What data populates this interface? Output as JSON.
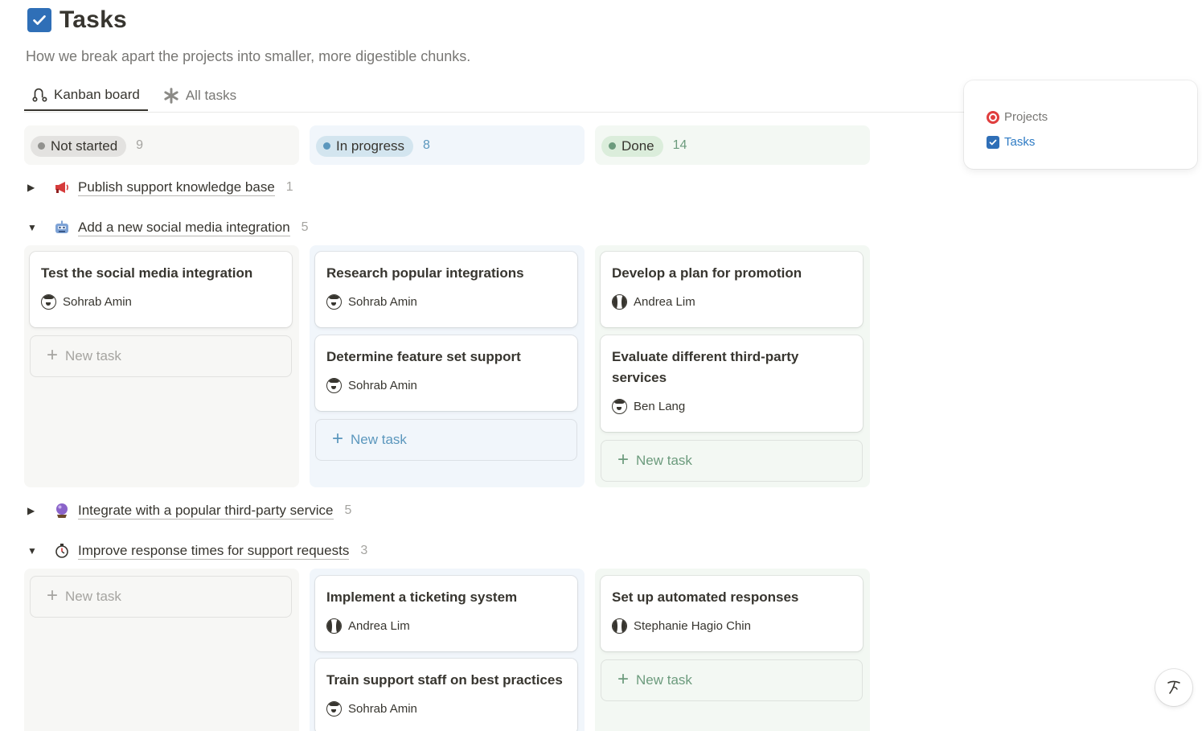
{
  "page": {
    "title": "Tasks",
    "description": "How we break apart the projects into smaller, more digestible chunks."
  },
  "tabs": [
    {
      "label": "Kanban board",
      "icon": "kanban-icon",
      "active": true
    },
    {
      "label": "All tasks",
      "icon": "asterisk-icon",
      "active": false
    }
  ],
  "popover": {
    "items": [
      {
        "label": "Projects",
        "icon": "target-icon"
      },
      {
        "label": "Tasks",
        "icon": "checkbox-icon"
      }
    ]
  },
  "columns": [
    {
      "label": "Not started",
      "count": "9",
      "color": "#91918e"
    },
    {
      "label": "In progress",
      "count": "8",
      "color": "#5b97bd"
    },
    {
      "label": "Done",
      "count": "14",
      "color": "#6c9b7d"
    }
  ],
  "groups": [
    {
      "title": "Publish support knowledge base",
      "count": "1",
      "icon": "megaphone-icon",
      "expanded": false
    },
    {
      "title": "Add a new social media integration",
      "count": "5",
      "icon": "robot-icon",
      "expanded": true
    },
    {
      "title": "Integrate with a popular third-party service",
      "count": "5",
      "icon": "crystal-ball-icon",
      "expanded": false
    },
    {
      "title": "Improve response times for support requests",
      "count": "3",
      "icon": "stopwatch-icon",
      "expanded": true
    }
  ],
  "cards": {
    "social_not_started": [
      {
        "title": "Test the social media integration",
        "person": "Sohrab Amin"
      }
    ],
    "social_in_progress": [
      {
        "title": "Research popular integrations",
        "person": "Sohrab Amin"
      },
      {
        "title": "Determine feature set support",
        "person": "Sohrab Amin"
      }
    ],
    "social_done": [
      {
        "title": "Develop a plan for promotion",
        "person": "Andrea Lim"
      },
      {
        "title": "Evaluate different third-party services",
        "person": "Ben Lang"
      }
    ],
    "response_in_progress": [
      {
        "title": "Implement a ticketing system",
        "person": "Andrea Lim"
      },
      {
        "title": "Train support staff on best practices",
        "person": "Sohrab Amin"
      }
    ],
    "response_done": [
      {
        "title": "Set up automated responses",
        "person": "Stephanie Hagio Chin"
      }
    ]
  },
  "new_task_label": "New task",
  "new_task_plus": "+",
  "caret_collapsed": "▶",
  "caret_expanded": "▼"
}
